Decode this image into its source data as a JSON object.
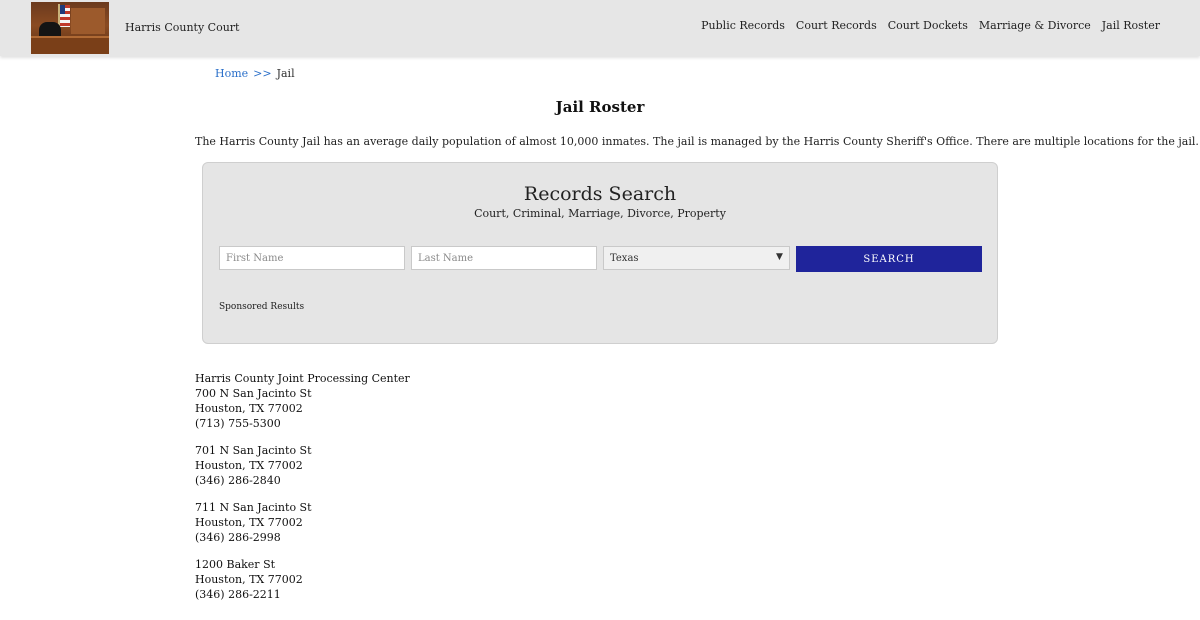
{
  "header": {
    "site_name": "Harris County Court",
    "nav": [
      {
        "label": "Public Records"
      },
      {
        "label": "Court Records"
      },
      {
        "label": "Court Dockets"
      },
      {
        "label": "Marriage & Divorce"
      },
      {
        "label": "Jail Roster"
      }
    ]
  },
  "breadcrumb": {
    "home": "Home",
    "separator": ">>",
    "current": "Jail"
  },
  "page": {
    "title": "Jail Roster",
    "intro": "The Harris County Jail has an average daily population of almost 10,000 inmates. The jail is managed by the Harris County Sheriff's Office. There are multiple locations for the jail."
  },
  "search": {
    "title": "Records Search",
    "subtitle": "Court, Criminal, Marriage, Divorce, Property",
    "first_name_placeholder": "First Name",
    "last_name_placeholder": "Last Name",
    "state_selected": "Texas",
    "button_label": "SEARCH",
    "sponsored": "Sponsored Results",
    "button_color": "#1f249b"
  },
  "locations": [
    {
      "lines": [
        "Harris County Joint Processing Center",
        "700 N San Jacinto St",
        "Houston, TX 77002",
        "(713) 755-5300"
      ]
    },
    {
      "lines": [
        "701 N San Jacinto St",
        "Houston, TX 77002",
        "(346) 286-2840"
      ]
    },
    {
      "lines": [
        "711 N San Jacinto St",
        "Houston, TX 77002",
        "(346) 286-2998"
      ]
    },
    {
      "lines": [
        "1200 Baker St",
        "Houston, TX 77002",
        "(346) 286-2211"
      ]
    }
  ]
}
